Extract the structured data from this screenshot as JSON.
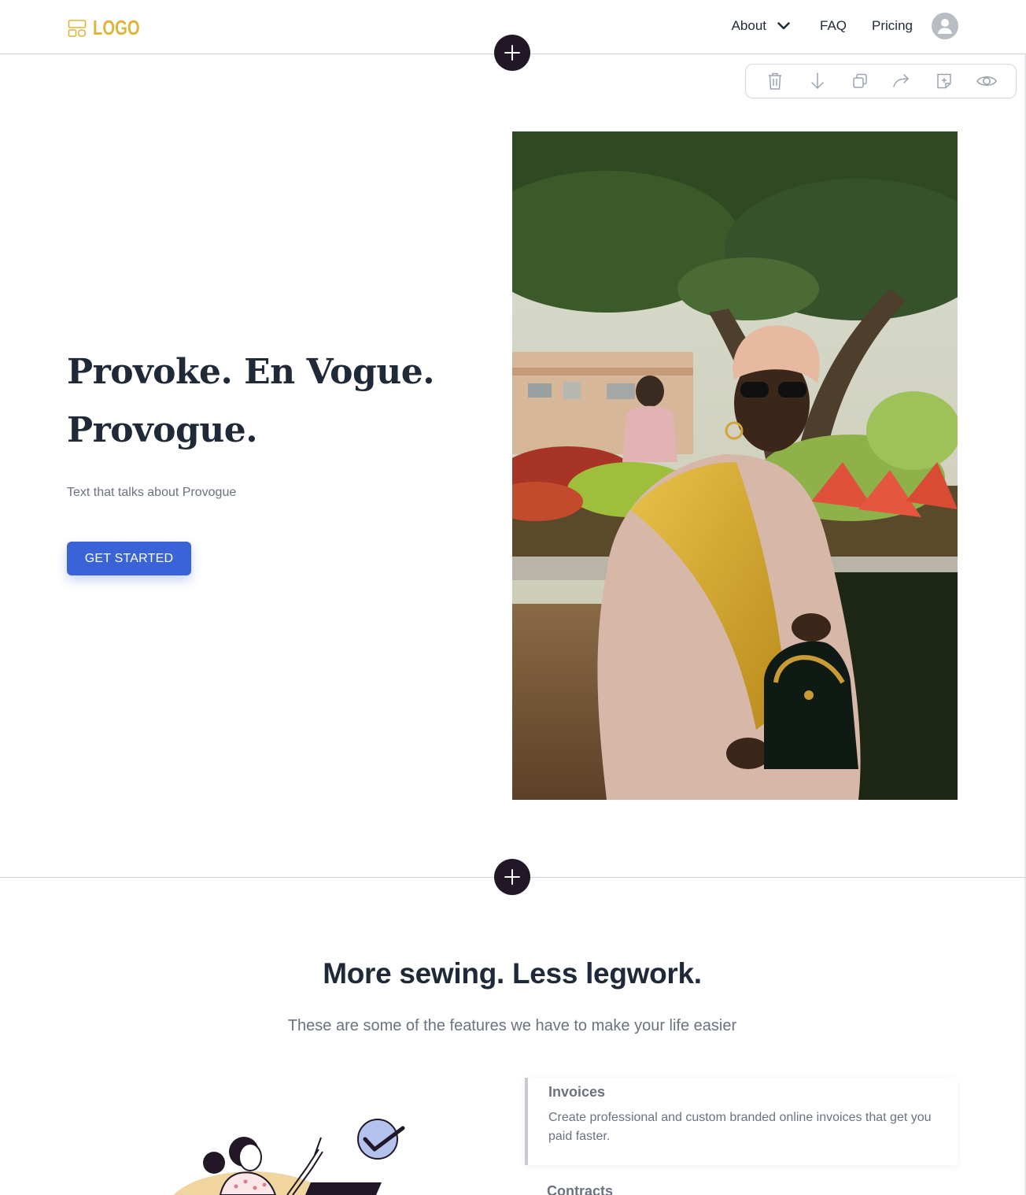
{
  "header": {
    "logo_text": "LOGO",
    "nav": [
      {
        "label": "About"
      },
      {
        "label": "FAQ"
      },
      {
        "label": "Pricing"
      }
    ]
  },
  "hero": {
    "title_line1": "Provoke. En Vogue.",
    "title_line2": "Provogue.",
    "subtitle": "Text that talks about Provogue",
    "cta_label": "GET STARTED"
  },
  "features": {
    "title": "More sewing. Less legwork.",
    "subtitle": "These are some of the features we have to make your life easier",
    "items": [
      {
        "title": "Invoices",
        "description": "Create professional and custom branded online invoices that get you paid faster."
      },
      {
        "title": "Contracts"
      }
    ]
  },
  "toolbar": {
    "icons": [
      "trash-icon",
      "arrow-down-icon",
      "duplicate-icon",
      "redo-icon",
      "add-note-icon",
      "eye-icon"
    ]
  },
  "colors": {
    "logo": "#e0b43a",
    "cta": "#3b63d8",
    "plus_button": "#221727",
    "heading": "#1f2937",
    "muted": "#6b7280"
  }
}
